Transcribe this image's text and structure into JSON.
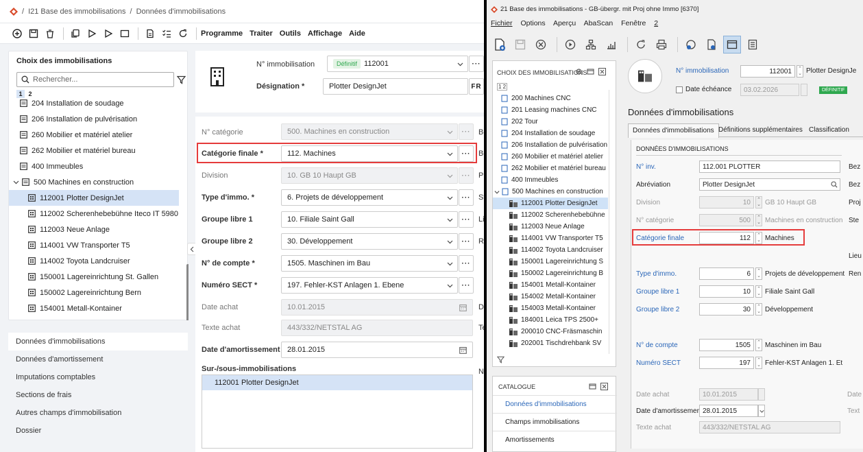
{
  "left": {
    "breadcrumb": {
      "sep": "/",
      "item1": "I21 Base des immobilisations",
      "item2": "Données d'immobilisations"
    },
    "menu": {
      "program": "Programme",
      "process": "Traiter",
      "tools": "Outils",
      "view": "Affichage",
      "help": "Aide"
    },
    "list_panel": {
      "title": "Choix des immobilisations",
      "search_placeholder": "Rechercher...",
      "tabs": [
        "1",
        "2"
      ],
      "items": [
        {
          "label": "204 Installation de soudage"
        },
        {
          "label": "206 Installation de pulvérisation"
        },
        {
          "label": "260 Mobilier et matériel atelier"
        },
        {
          "label": "262 Mobilier et matériel bureau"
        },
        {
          "label": "400 Immeubles"
        },
        {
          "label": "500 Machines en construction"
        },
        {
          "label": "112001 Plotter DesignJet"
        },
        {
          "label": "112002 Scherenhebebühne Iteco IT 5980"
        },
        {
          "label": "112003 Neue Anlage"
        },
        {
          "label": "114001 VW Transporter T5"
        },
        {
          "label": "114002 Toyota Landcruiser"
        },
        {
          "label": "150001 Lagereinrichtung St. Gallen"
        },
        {
          "label": "150002 Lagereinrichtung Bern"
        },
        {
          "label": "154001 Metall-Kontainer"
        }
      ]
    },
    "nav": [
      "Données d'immobilisations",
      "Données d'amortissement",
      "Imputations comptables",
      "Sections de frais",
      "Autres champs d'immobilisation",
      "Dossier"
    ],
    "header": {
      "asset_no_label": "N° immobilisation",
      "status_badge": "Définitif",
      "asset_no": "112001",
      "designation_label": "Désignation *",
      "designation": "Plotter DesignJet",
      "lang": "FR"
    },
    "fields": {
      "category_label": "N° catégorie",
      "category": "500. Machines en construction",
      "final_category_label": "Catégorie finale *",
      "final_category": "112. Machines",
      "division_label": "Division",
      "division": "10. GB 10 Haupt GB",
      "type_label": "Type d'immo. *",
      "type": "6. Projets de développement",
      "group1_label": "Groupe libre 1",
      "group1": "10. Filiale Saint Gall",
      "group2_label": "Groupe libre 2",
      "group2": "30. Développement",
      "account_label": "N° de compte *",
      "account": "1505. Maschinen im Bau",
      "sect_label": "Numéro SECT *",
      "sect": "197. Fehler-KST Anlagen 1. Ebene",
      "purchase_date_label": "Date achat",
      "purchase_date": "10.01.2015",
      "purchase_text_label": "Texte achat",
      "purchase_text": "443/332/NETSTAL AG",
      "depr_date_label": "Date d'amortissement",
      "depr_date": "28.01.2015",
      "sub_label": "Sur-/sous-immobilisations",
      "sub_item": "112001 Plotter DesignJet"
    },
    "trunc": [
      "Bo",
      "Bo",
      "Pi",
      "St",
      "Li",
      "Re",
      "Da",
      "Te",
      "N"
    ]
  },
  "right": {
    "title": "21 Base des immobilisations - GB-übergr. mit Proj ohne Immo [6370]",
    "menu": [
      "Fichier",
      "Options",
      "Aperçu",
      "AbaScan",
      "Fenêtre",
      "2"
    ],
    "tree": {
      "header": "CHOIX DES IMMOBILISATIONS",
      "tabs": "1 2",
      "items": [
        {
          "label": "200 Machines CNC"
        },
        {
          "label": "201 Leasing machines CNC"
        },
        {
          "label": "202 Tour"
        },
        {
          "label": "204 Installation de soudage"
        },
        {
          "label": "206 Installation de pulvérisation"
        },
        {
          "label": "260 Mobilier et matériel atelier"
        },
        {
          "label": "262 Mobilier et matériel bureau"
        },
        {
          "label": "400 Immeubles"
        },
        {
          "label": "500 Machines en construction"
        },
        {
          "label": "112001 Plotter DesignJet"
        },
        {
          "label": "112002 Scherenhebebühne"
        },
        {
          "label": "112003 Neue Anlage"
        },
        {
          "label": "114001 VW Transporter T5"
        },
        {
          "label": "114002 Toyota Landcruiser"
        },
        {
          "label": "150001 Lagereinrichtung S"
        },
        {
          "label": "150002 Lagereinrichtung B"
        },
        {
          "label": "154001 Metall-Kontainer"
        },
        {
          "label": "154002 Metall-Kontainer"
        },
        {
          "label": "154003 Metall-Kontainer"
        },
        {
          "label": "184001 Leica TPS 2500+"
        },
        {
          "label": "200010 CNC-Fräsmaschin"
        },
        {
          "label": "202001 Tischdrehbank SV"
        }
      ]
    },
    "catalog": {
      "header": "CATALOGUE",
      "items": [
        "Données d'immobilisations",
        "Champs immobilisations",
        "Amortissements"
      ]
    },
    "form": {
      "asset_no_label": "N° immobilisation",
      "asset_no": "112001",
      "asset_name": "Plotter DesignJe",
      "due_date_label": "Date échéance",
      "due_date": "03.02.2026",
      "status": "DÉFINITIF",
      "section_title": "Données d'immobilisations",
      "tabs": [
        "Données d'immobilisations",
        "Définitions supplémentaires",
        "Classification"
      ],
      "group_title": "DONNÉES D'IMMOBILISATIONS",
      "inv_label": "N° inv.",
      "inv": "112.001 PLOTTER",
      "abbr_label": "Abréviation",
      "abbr": "Plotter DesignJet",
      "division_label": "Division",
      "division_no": "10",
      "division_name": "GB 10 Haupt GB",
      "category_label": "N° catégorie",
      "category_no": "500",
      "category_name": "Machines en construction",
      "final_cat_label": "Catégorie finale",
      "final_cat_no": "112",
      "final_cat_name": "Machines",
      "type_label": "Type d'immo.",
      "type_no": "6",
      "type_name": "Projets de développement",
      "group1_label": "Groupe libre 1",
      "group1_no": "10",
      "group1_name": "Filiale Saint Gall",
      "group2_label": "Groupe libre 2",
      "group2_no": "30",
      "group2_name": "Développement",
      "account_label": "N° de compte",
      "account_no": "1505",
      "account_name": "Maschinen im Bau",
      "sect_label": "Numéro SECT",
      "sect_no": "197",
      "sect_name": "Fehler-KST Anlagen 1. Et",
      "purchase_date_label": "Date achat",
      "purchase_date": "10.01.2015",
      "depr_date_label": "Date d'amortissement",
      "depr_date": "28.01.2015",
      "purchase_text_label": "Texte achat",
      "purchase_text": "443/332/NETSTAL AG",
      "trunc": [
        "Bez",
        "Bez",
        "Proj",
        "Ste",
        "Lieu",
        "Ren",
        "Date",
        "Text"
      ]
    }
  },
  "colors": {
    "highlight": "#e53b3b",
    "accent": "#2a66b8",
    "selected": "#d5e3f6",
    "badge": "#2fa84f"
  }
}
